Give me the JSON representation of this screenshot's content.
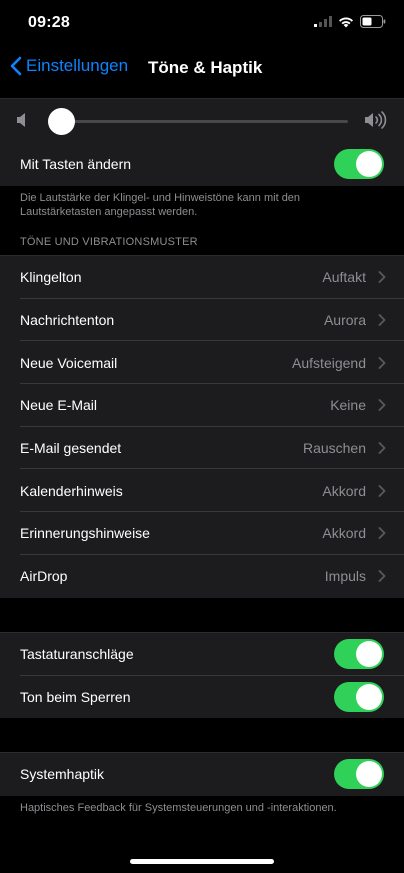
{
  "status": {
    "time": "09:28"
  },
  "nav": {
    "back_label": "Einstellungen",
    "title": "Töne & Haptik"
  },
  "volume": {
    "level": 0.01
  },
  "change_with_buttons": {
    "label": "Mit Tasten ändern",
    "on": true
  },
  "volume_footnote": "Die Lautstärke der Klingel- und Hinweistöne kann mit den Lautstärketasten angepasst werden.",
  "sounds_section": {
    "header": "TÖNE UND VIBRATIONSMUSTER",
    "items": [
      {
        "label": "Klingelton",
        "value": "Auftakt"
      },
      {
        "label": "Nachrichtenton",
        "value": "Aurora"
      },
      {
        "label": "Neue Voicemail",
        "value": "Aufsteigend"
      },
      {
        "label": "Neue E-Mail",
        "value": "Keine"
      },
      {
        "label": "E-Mail gesendet",
        "value": "Rauschen"
      },
      {
        "label": "Kalenderhinweis",
        "value": "Akkord"
      },
      {
        "label": "Erinnerungshinweise",
        "value": "Akkord"
      },
      {
        "label": "AirDrop",
        "value": "Impuls"
      }
    ]
  },
  "keyboard_clicks": {
    "label": "Tastaturanschläge",
    "on": true
  },
  "lock_sound": {
    "label": "Ton beim Sperren",
    "on": true
  },
  "system_haptics": {
    "label": "Systemhaptik",
    "on": true
  },
  "haptics_footnote": "Haptisches Feedback für Systemsteuerungen und -interaktionen.",
  "colors": {
    "accent": "#0a84ff",
    "toggle_on": "#30d158",
    "cell_bg": "#1c1c1e",
    "secondary_text": "#8e8e93"
  },
  "icons": [
    "cellular-signal-icon",
    "wifi-icon",
    "battery-icon",
    "chevron-left-icon",
    "speaker-icon",
    "speaker-loud-icon",
    "chevron-right-icon"
  ]
}
